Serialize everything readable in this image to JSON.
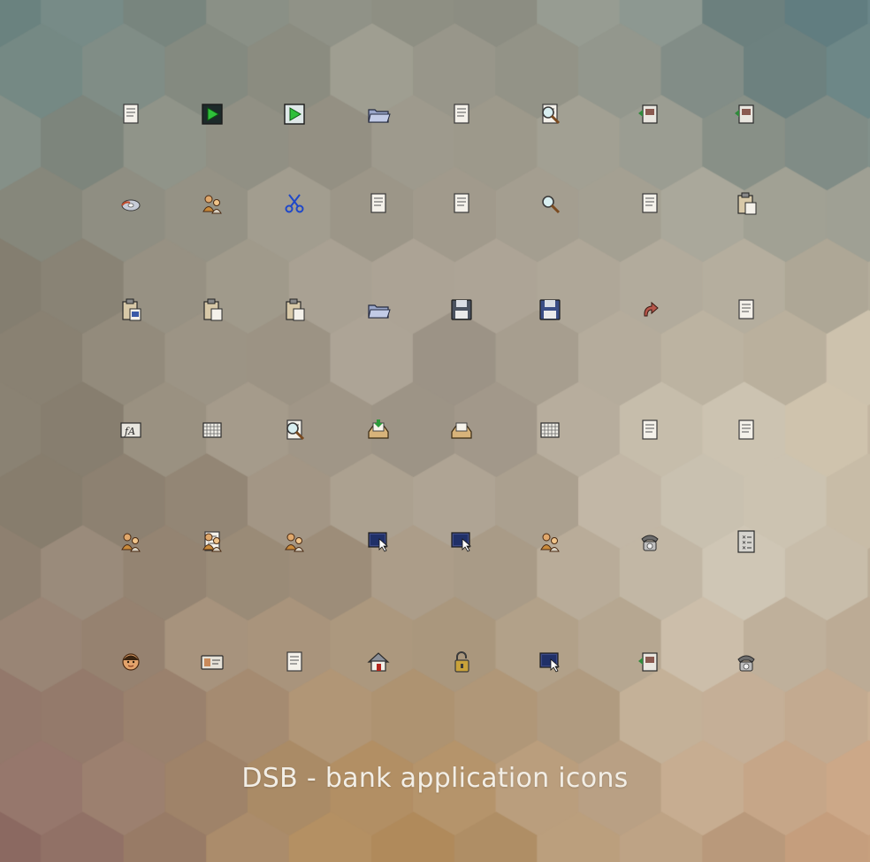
{
  "caption": "DSB - bank application icons",
  "palette": {
    "bg_top_left": "#6f8784",
    "bg_top_right": "#5f7d80",
    "bg_mid": "#a59c8f",
    "bg_mid_right": "#c9bca6",
    "bg_bottom_left": "#8a6860",
    "bg_bottom_mid": "#b08a5a",
    "bg_bottom_right": "#c8a07e"
  },
  "icon_rows": [
    [
      "document-close-icon",
      "play-green-icon",
      "play-green-outline-icon",
      "folder-in-icon",
      "paper-stack-icon",
      "search-document-icon",
      "document-move-icon",
      "network-transfer-icon"
    ],
    [
      "cd-disc-icon",
      "people-cut-icon",
      "blue-scissors-icon",
      "document-down-icon",
      "trash-documents-icon",
      "magnifier-icon",
      "document-copy-icon",
      "clipboard-paste-icon"
    ],
    [
      "clipboard-paste-blue-icon",
      "clipboard-edit-icon",
      "clipboard-arrow-icon",
      "folder-open-icon",
      "floppy-save-icon",
      "floppy-save-blue-icon",
      "undo-arrow-icon",
      "document-text-icon"
    ],
    [
      "function-icon",
      "spreadsheet-grid-icon",
      "search-text-icon",
      "inbox-tray-icon",
      "mail-tray-icon",
      "table-list-icon",
      "bullet-list-icon",
      "notepad-icon"
    ],
    [
      "people-group-icon",
      "document-hand-icon",
      "hand-sparkle-icon",
      "window-shortcut-icon",
      "screen-cursor-icon",
      "people-exchange-icon",
      "phone-transfer-icon",
      "checklist-x-icon"
    ],
    [
      "person-face-icon",
      "id-card-icon",
      "documents-compare-icon",
      "home-icon",
      "padlock-icon",
      "laptop-download-icon",
      "card-reader-icon",
      "telephone-icon"
    ]
  ]
}
